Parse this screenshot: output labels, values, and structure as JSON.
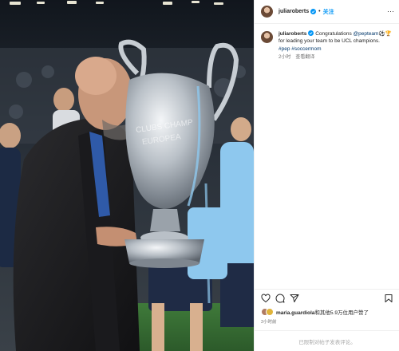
{
  "post": {
    "author": "juliaroberts",
    "follow_label": "关注",
    "separator": "•",
    "more": "···",
    "caption": {
      "username": "juliaroberts",
      "text_before": " Congratulations ",
      "mention": "@pepteam",
      "text_after": " for leading your team to be UCL champions.",
      "emojis": "⚽🏆",
      "hashtag_1": "#pep",
      "hashtag_2": "#soccermom",
      "time": "2小时",
      "translate": "查看翻译"
    },
    "image": {
      "trophy_text_1": "CLUBS CHAMP",
      "trophy_text_2": "EUROPEA"
    },
    "likes": {
      "user": "maria.guardiola",
      "text": "和其他5.9万位用户赞了"
    },
    "time_ago": "2小时前",
    "comment_placeholder": "已限制对帖子发表评论。"
  },
  "icons": {
    "like": "heart-icon",
    "comment": "comment-icon",
    "share": "paper-plane-icon",
    "save": "bookmark-icon",
    "verified": "verified-badge-icon",
    "more": "more-options-icon"
  },
  "colors": {
    "link": "#00376b",
    "follow": "#0095f6",
    "verified": "#0095f6",
    "muted": "#737373",
    "text": "#262626"
  }
}
